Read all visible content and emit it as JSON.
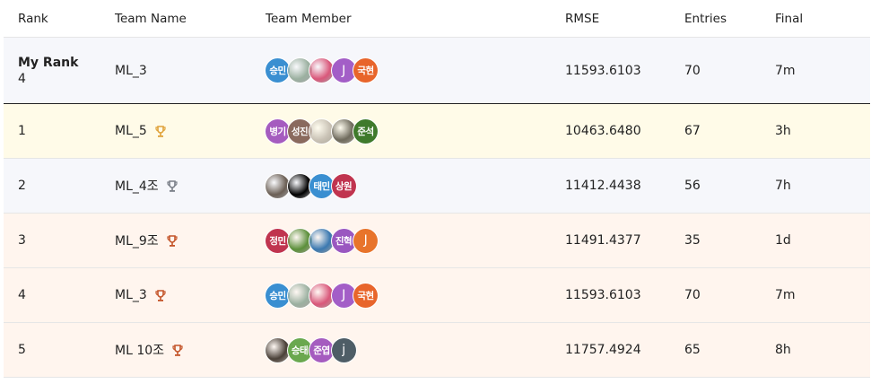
{
  "header": {
    "rank": "Rank",
    "team_name": "Team Name",
    "team_member": "Team Member",
    "metric": "RMSE",
    "entries": "Entries",
    "final": "Final"
  },
  "my_rank": {
    "label": "My Rank",
    "rank": "4",
    "team": "ML_3",
    "members": [
      {
        "text": "승민",
        "kind": "initials",
        "color": "#3a8fd1"
      },
      {
        "text": "",
        "kind": "photo",
        "color": "#9bb0a0"
      },
      {
        "text": "",
        "kind": "photo",
        "color": "#d9577a"
      },
      {
        "text": "J",
        "kind": "letter",
        "color": "#a35ec7"
      },
      {
        "text": "국현",
        "kind": "initials",
        "color": "#e8652b"
      }
    ],
    "rmse": "11593.6103",
    "entries": "70",
    "final": "7m"
  },
  "rows": [
    {
      "rank": "1",
      "team": "ML_5",
      "medal": "gold",
      "members": [
        {
          "text": "병기",
          "kind": "initials",
          "color": "#a55cbf"
        },
        {
          "text": "성진",
          "kind": "initials",
          "color": "#8a6a5e"
        },
        {
          "text": "",
          "kind": "photo",
          "color": "#c9c2b5"
        },
        {
          "text": "",
          "kind": "photo",
          "color": "#6e6a5c"
        },
        {
          "text": "준석",
          "kind": "initials",
          "color": "#3f7a2c"
        }
      ],
      "rmse": "10463.6480",
      "entries": "67",
      "final": "3h"
    },
    {
      "rank": "2",
      "team": "ML_4조",
      "medal": "silver",
      "members": [
        {
          "text": "",
          "kind": "photo",
          "color": "#6b5f55"
        },
        {
          "text": "",
          "kind": "photo",
          "color": "#000000"
        },
        {
          "text": "태민",
          "kind": "initials",
          "color": "#3a8fd1"
        },
        {
          "text": "상원",
          "kind": "initials",
          "color": "#c0344f"
        }
      ],
      "rmse": "11412.4438",
      "entries": "56",
      "final": "7h"
    },
    {
      "rank": "3",
      "team": "ML_9조",
      "medal": "bronze",
      "members": [
        {
          "text": "정민",
          "kind": "initials",
          "color": "#c0344f"
        },
        {
          "text": "",
          "kind": "photo",
          "color": "#5b8f3a"
        },
        {
          "text": "",
          "kind": "photo",
          "color": "#3a78b0"
        },
        {
          "text": "진혁",
          "kind": "initials",
          "color": "#9a57c0"
        },
        {
          "text": "J",
          "kind": "letter",
          "color": "#e8742b"
        }
      ],
      "rmse": "11491.4377",
      "entries": "35",
      "final": "1d"
    },
    {
      "rank": "4",
      "team": "ML_3",
      "medal": "bronze",
      "members": [
        {
          "text": "승민",
          "kind": "initials",
          "color": "#3a8fd1"
        },
        {
          "text": "",
          "kind": "photo",
          "color": "#9bb0a0"
        },
        {
          "text": "",
          "kind": "photo",
          "color": "#d9577a"
        },
        {
          "text": "J",
          "kind": "letter",
          "color": "#a35ec7"
        },
        {
          "text": "국현",
          "kind": "initials",
          "color": "#e8652b"
        }
      ],
      "rmse": "11593.6103",
      "entries": "70",
      "final": "7m"
    },
    {
      "rank": "5",
      "team": "ML 10조",
      "medal": "bronze",
      "members": [
        {
          "text": "",
          "kind": "photo",
          "color": "#4a4038"
        },
        {
          "text": "승태",
          "kind": "initials",
          "color": "#6aa84f"
        },
        {
          "text": "준엽",
          "kind": "initials",
          "color": "#a55cbf"
        },
        {
          "text": "j",
          "kind": "letter",
          "color": "#4e5d66"
        }
      ],
      "rmse": "11757.4924",
      "entries": "65",
      "final": "8h"
    }
  ],
  "medal_colors": {
    "gold": "#e0a23a",
    "silver": "#7a7f88",
    "bronze": "#c4552a"
  }
}
